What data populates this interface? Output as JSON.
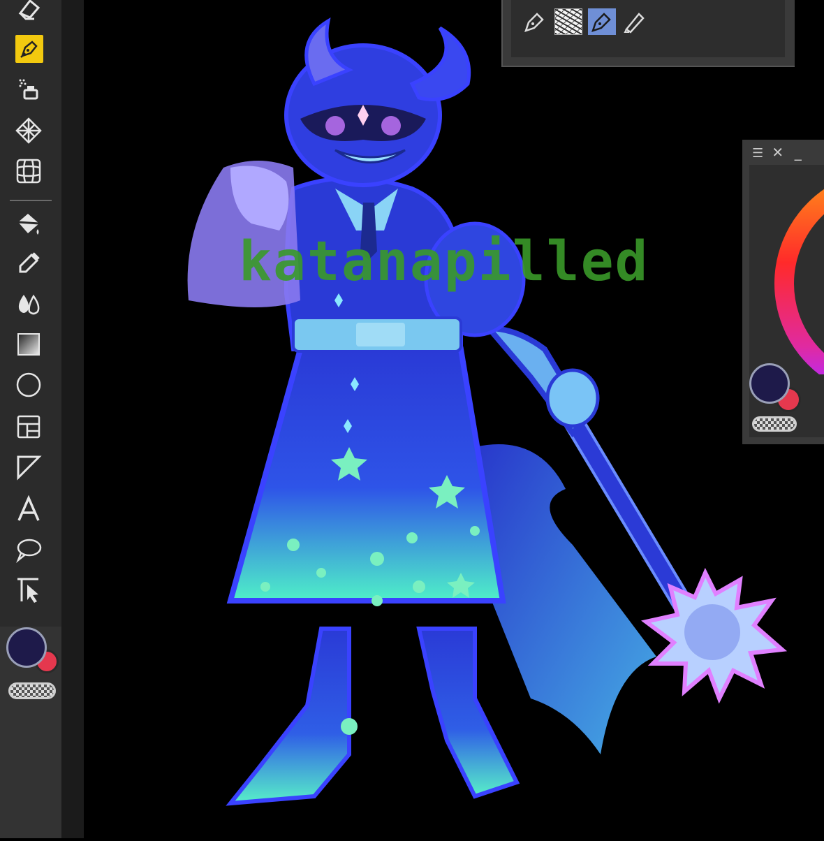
{
  "watermark": {
    "text": "katanapilled"
  },
  "toolbar": {
    "tools": [
      {
        "name": "eraser-icon"
      },
      {
        "name": "pen-icon",
        "active": true
      },
      {
        "name": "airbrush-icon"
      },
      {
        "name": "pattern-icon"
      },
      {
        "name": "grid-transform-icon"
      },
      {
        "name": "fill-bucket-icon"
      },
      {
        "name": "eyedropper-icon"
      },
      {
        "name": "blend-drops-icon"
      },
      {
        "name": "gradient-icon"
      },
      {
        "name": "shape-circle-icon"
      },
      {
        "name": "frame-divider-icon"
      },
      {
        "name": "ruler-triangle-icon"
      },
      {
        "name": "text-icon",
        "glyph": "A"
      },
      {
        "name": "speech-balloon-icon"
      },
      {
        "name": "selection-move-icon"
      }
    ],
    "colors": {
      "foreground": "#1e1a4a",
      "background": "#e5384e"
    }
  },
  "brush_panel": {
    "slots": [
      {
        "name": "ink-pen-brush-icon"
      },
      {
        "name": "sketch-thumbnail-brush"
      },
      {
        "name": "selected-pen-brush-icon",
        "selected": true
      },
      {
        "name": "marker-brush-icon"
      }
    ]
  },
  "color_panel": {
    "foreground": "#1e1a4a",
    "background": "#e5384e",
    "accent": "#f2c90f"
  }
}
